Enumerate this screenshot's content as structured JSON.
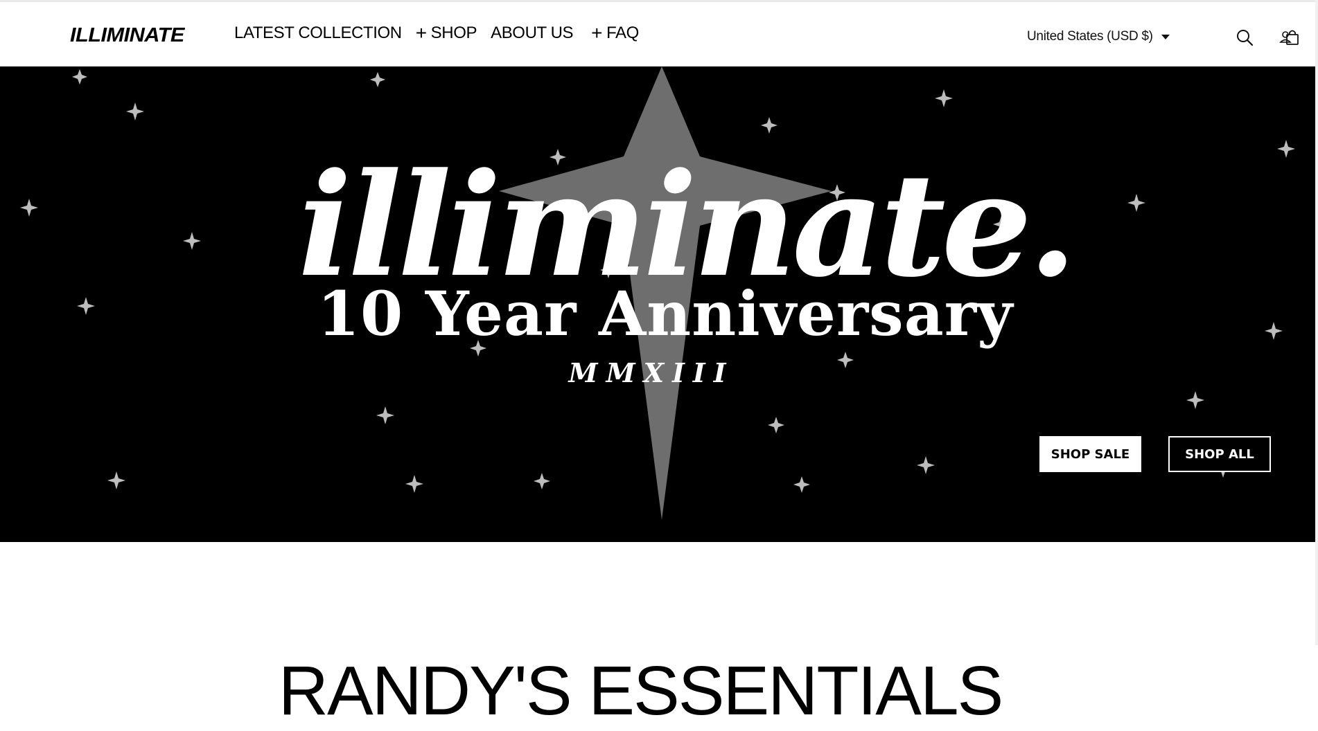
{
  "header": {
    "logo": "ILLIMINATE",
    "nav": [
      {
        "label": "LATEST COLLECTION",
        "has_plus": false
      },
      {
        "label": "SHOP",
        "has_plus": true
      },
      {
        "label": "ABOUT US",
        "has_plus": false
      },
      {
        "label": "FAQ",
        "has_plus": true
      }
    ],
    "currency": "United States (USD $)",
    "icons": [
      "search-icon",
      "account-icon",
      "cart-icon"
    ]
  },
  "hero": {
    "script_title": "illiminate.",
    "subtitle": "10 Year Anniversary",
    "roman": "MMXIII",
    "buttons": {
      "shop_sale": "SHOP SALE",
      "shop_all": "SHOP ALL"
    },
    "background": "#000000",
    "star_color": "#6e6e6e"
  },
  "section": {
    "title": "RANDY'S ESSENTIALS"
  }
}
